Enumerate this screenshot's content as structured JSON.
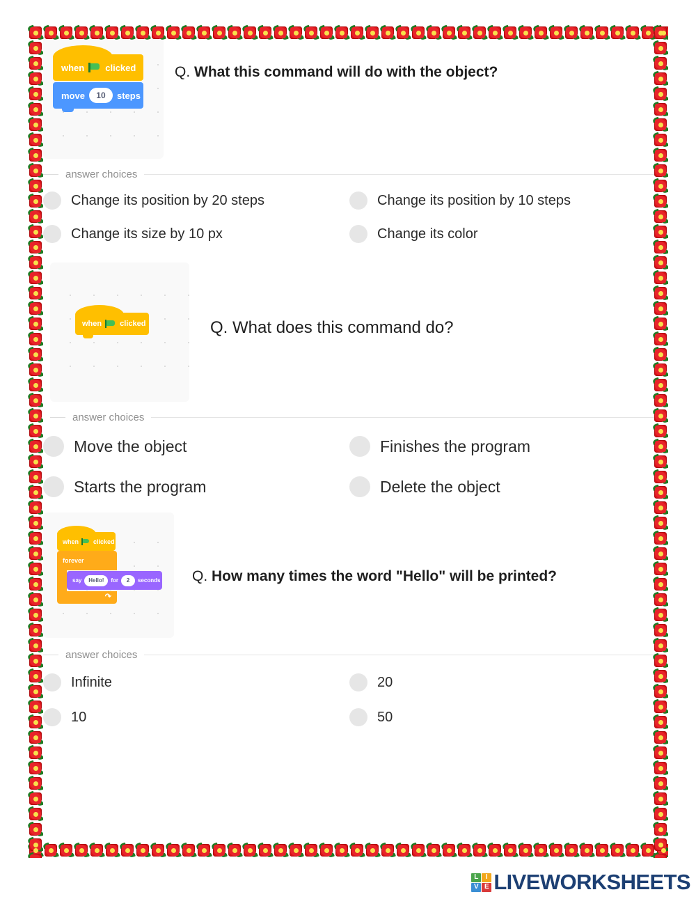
{
  "worksheet": {
    "answer_choices_label": "answer choices",
    "question_prefix": "Q.",
    "border_decoration": "flower-border",
    "colors": {
      "flower_petal": "#d81317",
      "flower_core": "#f8e14b",
      "flower_leaf": "#1f7a22",
      "scratch_hat": "#ffbf00",
      "scratch_motion": "#4c97ff",
      "scratch_control": "#ffab19",
      "scratch_looks": "#9966ff",
      "radio_fill": "#e6e6e6",
      "panel_bg": "#f9f9f9",
      "logo_navy": "#1c3f73"
    }
  },
  "questions": [
    {
      "id": "q1",
      "text": "What this command will do with the object?",
      "emphasis": "bold",
      "blocks": [
        {
          "type": "hat",
          "words": [
            "when",
            "flag",
            "clicked"
          ]
        },
        {
          "type": "motion",
          "words": [
            "move",
            "10",
            "steps"
          ],
          "value": "10"
        }
      ],
      "choices": [
        "Change its position by 20 steps",
        "Change its position by 10 steps",
        "Change its size by 10 px",
        "Change its color"
      ]
    },
    {
      "id": "q2",
      "text": "What does this command do?",
      "emphasis": "light",
      "blocks": [
        {
          "type": "hat",
          "words": [
            "when",
            "flag",
            "clicked"
          ]
        }
      ],
      "choices": [
        "Move the object",
        "Finishes the program",
        "Starts the program",
        "Delete the object"
      ]
    },
    {
      "id": "q3",
      "text": "How many times the word \"Hello\" will be printed?",
      "emphasis": "bold",
      "blocks": [
        {
          "type": "hat",
          "words": [
            "when",
            "flag",
            "clicked"
          ]
        },
        {
          "type": "control",
          "words": [
            "forever"
          ]
        },
        {
          "type": "looks",
          "words": [
            "say",
            "Hello!",
            "for",
            "2",
            "seconds"
          ],
          "message": "Hello!",
          "seconds": "2"
        }
      ],
      "choices": [
        "Infinite",
        "20",
        "10",
        "50"
      ]
    }
  ],
  "scratch_labels": {
    "when": "when",
    "clicked": "clicked",
    "move": "move",
    "steps": "steps",
    "ten": "10",
    "forever": "forever",
    "say": "say",
    "hello": "Hello!",
    "for": "for",
    "two": "2",
    "seconds": "seconds"
  },
  "footer": {
    "brand": "LIVEWORKSHEETS",
    "tiles": [
      {
        "letter": "L",
        "color": "#4aa54a"
      },
      {
        "letter": "I",
        "color": "#f2a71b"
      },
      {
        "letter": "V",
        "color": "#3b8fd4"
      },
      {
        "letter": "E",
        "color": "#d93b3b"
      }
    ]
  }
}
